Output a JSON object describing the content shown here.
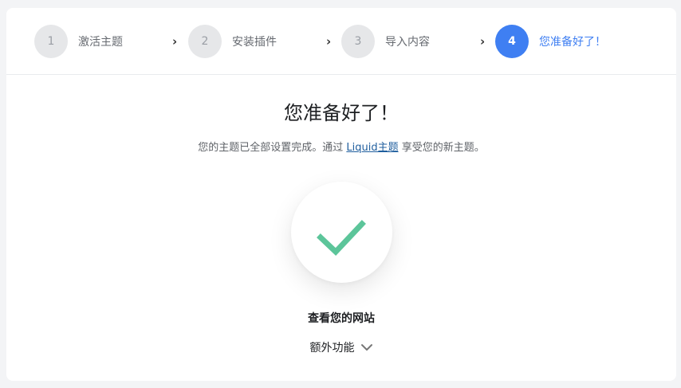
{
  "steps": [
    {
      "number": "1",
      "label": "激活主题"
    },
    {
      "number": "2",
      "label": "安装插件"
    },
    {
      "number": "3",
      "label": "导入内容"
    },
    {
      "number": "4",
      "label": "您准备好了！"
    }
  ],
  "step_separator": "›",
  "main": {
    "title": "您准备好了！",
    "subtitle_before": "您的主题已全部设置完成。通过 ",
    "subtitle_link": "Liquid主题",
    "subtitle_after": " 享受您的新主题。",
    "view_site_label": "查看您的网站",
    "extras_label": "额外功能"
  },
  "colors": {
    "accent": "#3f7ff2",
    "check": "#5cc59a",
    "link": "#1f5e9e"
  },
  "icons": {
    "success": "checkmark-icon",
    "expand": "chevron-down-icon"
  }
}
